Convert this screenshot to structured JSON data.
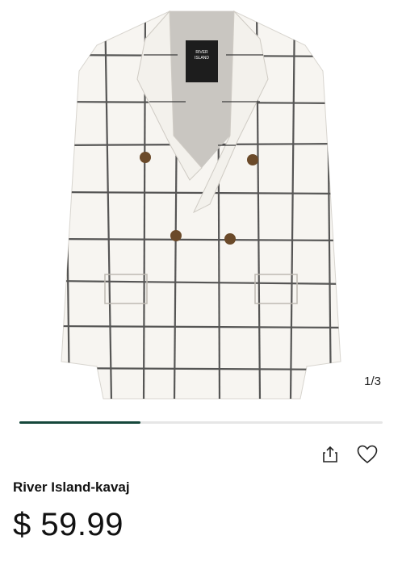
{
  "gallery": {
    "image_alt": "Product image",
    "counter": "1/3",
    "progress": 0.333,
    "accent_color": "#15473b"
  },
  "label_tag": {
    "brand_line1": "RIVER",
    "brand_line2": "ISLAND"
  },
  "actions": {
    "share_icon": "share-icon",
    "favorite_icon": "heart-icon"
  },
  "product": {
    "title": "River Island-kavaj",
    "price": "$ 59.99"
  }
}
